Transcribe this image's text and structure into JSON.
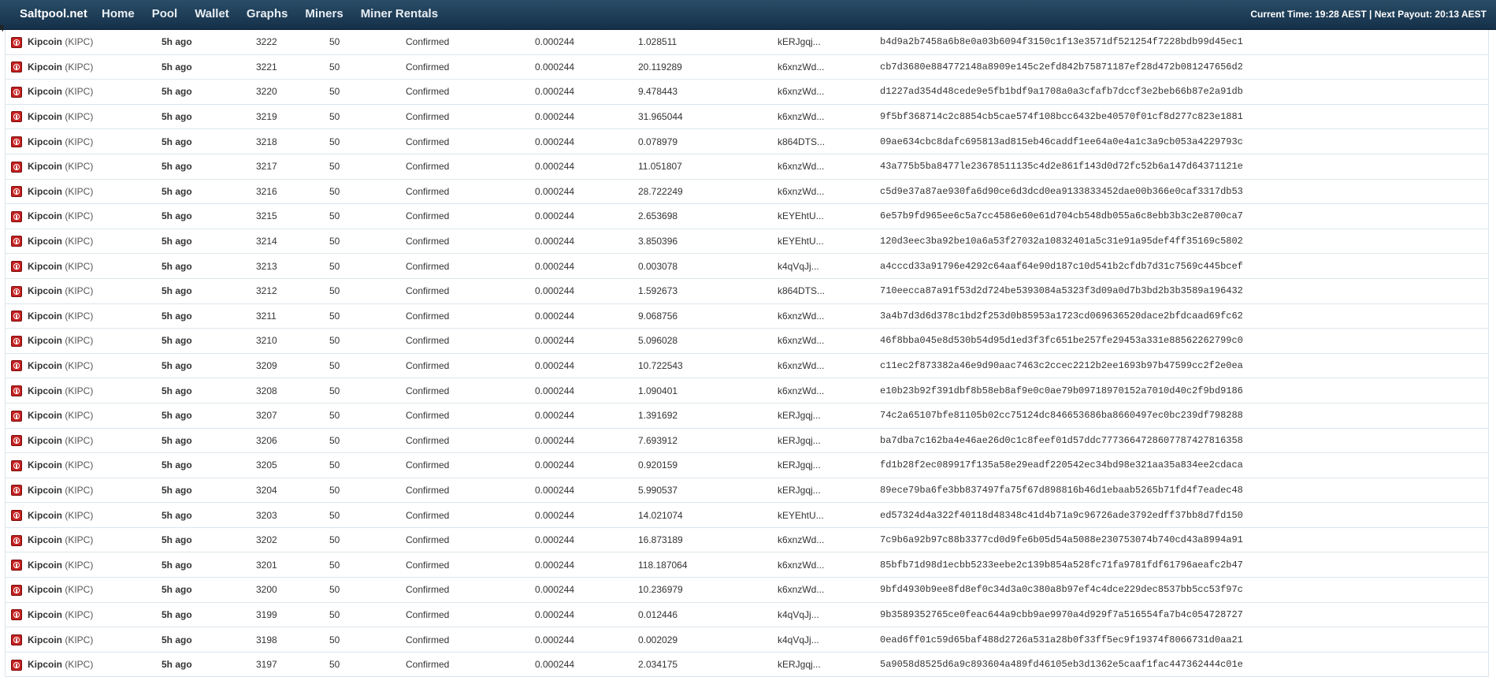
{
  "nav": {
    "brand": "Saltpool.net",
    "links": [
      "Home",
      "Pool",
      "Wallet",
      "Graphs",
      "Miners",
      "Miner Rentals"
    ],
    "status": "Current Time: 19:28 AEST | Next Payout: 20:13 AEST"
  },
  "coin": {
    "name": "Kipcoin",
    "ticker": "(KIPC)",
    "icon": "kipcoin-icon",
    "icon_color": "#c42020"
  },
  "blocks": [
    {
      "time": "5h ago",
      "height": "3222",
      "confirmations": "50",
      "status": "Confirmed",
      "difficulty": "0.000244",
      "reward": "1.028511",
      "finder": "kERJgqj...",
      "hash": "b4d9a2b7458a6b8e0a03b6094f3150c1f13e3571df521254f7228bdb99d45ec1"
    },
    {
      "time": "5h ago",
      "height": "3221",
      "confirmations": "50",
      "status": "Confirmed",
      "difficulty": "0.000244",
      "reward": "20.119289",
      "finder": "k6xnzWd...",
      "hash": "cb7d3680e884772148a8909e145c2efd842b75871187ef28d472b081247656d2"
    },
    {
      "time": "5h ago",
      "height": "3220",
      "confirmations": "50",
      "status": "Confirmed",
      "difficulty": "0.000244",
      "reward": "9.478443",
      "finder": "k6xnzWd...",
      "hash": "d1227ad354d48cede9e5fb1bdf9a1708a0a3cfafb7dccf3e2beb66b87e2a91db"
    },
    {
      "time": "5h ago",
      "height": "3219",
      "confirmations": "50",
      "status": "Confirmed",
      "difficulty": "0.000244",
      "reward": "31.965044",
      "finder": "k6xnzWd...",
      "hash": "9f5bf368714c2c8854cb5cae574f108bcc6432be40570f01cf8d277c823e1881"
    },
    {
      "time": "5h ago",
      "height": "3218",
      "confirmations": "50",
      "status": "Confirmed",
      "difficulty": "0.000244",
      "reward": "0.078979",
      "finder": "k864DTS...",
      "hash": "09ae634cbc8dafc695813ad815eb46caddf1ee64a0e4a1c3a9cb053a4229793c"
    },
    {
      "time": "5h ago",
      "height": "3217",
      "confirmations": "50",
      "status": "Confirmed",
      "difficulty": "0.000244",
      "reward": "11.051807",
      "finder": "k6xnzWd...",
      "hash": "43a775b5ba8477le23678511135c4d2e861f143d0d72fc52b6a147d64371121e"
    },
    {
      "time": "5h ago",
      "height": "3216",
      "confirmations": "50",
      "status": "Confirmed",
      "difficulty": "0.000244",
      "reward": "28.722249",
      "finder": "k6xnzWd...",
      "hash": "c5d9e37a87ae930fa6d90ce6d3dcd0ea9133833452dae00b366e0caf3317db53"
    },
    {
      "time": "5h ago",
      "height": "3215",
      "confirmations": "50",
      "status": "Confirmed",
      "difficulty": "0.000244",
      "reward": "2.653698",
      "finder": "kEYEhtU...",
      "hash": "6e57b9fd965ee6c5a7cc4586e60e61d704cb548db055a6c8ebb3b3c2e8700ca7"
    },
    {
      "time": "5h ago",
      "height": "3214",
      "confirmations": "50",
      "status": "Confirmed",
      "difficulty": "0.000244",
      "reward": "3.850396",
      "finder": "kEYEhtU...",
      "hash": "120d3eec3ba92be10a6a53f27032a10832401a5c31e91a95def4ff35169c5802"
    },
    {
      "time": "5h ago",
      "height": "3213",
      "confirmations": "50",
      "status": "Confirmed",
      "difficulty": "0.000244",
      "reward": "0.003078",
      "finder": "k4qVqJj...",
      "hash": "a4cccd33a91796e4292c64aaf64e90d187c10d541b2cfdb7d31c7569c445bcef"
    },
    {
      "time": "5h ago",
      "height": "3212",
      "confirmations": "50",
      "status": "Confirmed",
      "difficulty": "0.000244",
      "reward": "1.592673",
      "finder": "k864DTS...",
      "hash": "710eecca87a91f53d2d724be5393084a5323f3d09a0d7b3bd2b3b3589a196432"
    },
    {
      "time": "5h ago",
      "height": "3211",
      "confirmations": "50",
      "status": "Confirmed",
      "difficulty": "0.000244",
      "reward": "9.068756",
      "finder": "k6xnzWd...",
      "hash": "3a4b7d3d6d378c1bd2f253d0b85953a1723cd069636520dace2bfdcaad69fc62"
    },
    {
      "time": "5h ago",
      "height": "3210",
      "confirmations": "50",
      "status": "Confirmed",
      "difficulty": "0.000244",
      "reward": "5.096028",
      "finder": "k6xnzWd...",
      "hash": "46f8bba045e8d530b54d95d1ed3f3fc651be257fe29453a331e88562262799c0"
    },
    {
      "time": "5h ago",
      "height": "3209",
      "confirmations": "50",
      "status": "Confirmed",
      "difficulty": "0.000244",
      "reward": "10.722543",
      "finder": "k6xnzWd...",
      "hash": "c11ec2f873382a46e9d90aac7463c2ccec2212b2ee1693b97b47599cc2f2e0ea"
    },
    {
      "time": "5h ago",
      "height": "3208",
      "confirmations": "50",
      "status": "Confirmed",
      "difficulty": "0.000244",
      "reward": "1.090401",
      "finder": "k6xnzWd...",
      "hash": "e10b23b92f391dbf8b58eb8af9e0c0ae79b09718970152a7010d40c2f9bd9186"
    },
    {
      "time": "5h ago",
      "height": "3207",
      "confirmations": "50",
      "status": "Confirmed",
      "difficulty": "0.000244",
      "reward": "1.391692",
      "finder": "kERJgqj...",
      "hash": "74c2a65107bfe81105b02cc75124dc846653686ba8660497ec0bc239df798288"
    },
    {
      "time": "5h ago",
      "height": "3206",
      "confirmations": "50",
      "status": "Confirmed",
      "difficulty": "0.000244",
      "reward": "7.693912",
      "finder": "kERJgqj...",
      "hash": "ba7dba7c162ba4e46ae26d0c1c8feef01d57ddc777366472860778742781635​8"
    },
    {
      "time": "5h ago",
      "height": "3205",
      "confirmations": "50",
      "status": "Confirmed",
      "difficulty": "0.000244",
      "reward": "0.920159",
      "finder": "kERJgqj...",
      "hash": "fd1b28f2ec089917f135a58e29eadf220542ec34bd98e321aa35a834ee2cdaca"
    },
    {
      "time": "5h ago",
      "height": "3204",
      "confirmations": "50",
      "status": "Confirmed",
      "difficulty": "0.000244",
      "reward": "5.990537",
      "finder": "kERJgqj...",
      "hash": "89ece79ba6fe3bb837497fa75f67d898816b46d1ebaab5265b71fd4f7eadec48"
    },
    {
      "time": "5h ago",
      "height": "3203",
      "confirmations": "50",
      "status": "Confirmed",
      "difficulty": "0.000244",
      "reward": "14.021074",
      "finder": "kEYEhtU...",
      "hash": "ed57324d4a322f40118d48348c41d4b71a9c96726ade3792edff37bb8d7fd150"
    },
    {
      "time": "5h ago",
      "height": "3202",
      "confirmations": "50",
      "status": "Confirmed",
      "difficulty": "0.000244",
      "reward": "16.873189",
      "finder": "k6xnzWd...",
      "hash": "7c9b6a92b97c88b3377cd0d9fe6b05d54a5088e230753074b740cd43a8994a91"
    },
    {
      "time": "5h ago",
      "height": "3201",
      "confirmations": "50",
      "status": "Confirmed",
      "difficulty": "0.000244",
      "reward": "118.187064",
      "finder": "k6xnzWd...",
      "hash": "85bfb71d98d1ecbb5233eebe2c139b854a528fc71fa9781fdf61796aeafc2b47"
    },
    {
      "time": "5h ago",
      "height": "3200",
      "confirmations": "50",
      "status": "Confirmed",
      "difficulty": "0.000244",
      "reward": "10.236979",
      "finder": "k6xnzWd...",
      "hash": "9bfd4930b9ee8fd8ef0c34d3a0c380a8b97ef4c4dce229dec8537bb5cc53f97c"
    },
    {
      "time": "5h ago",
      "height": "3199",
      "confirmations": "50",
      "status": "Confirmed",
      "difficulty": "0.000244",
      "reward": "0.012446",
      "finder": "k4qVqJj...",
      "hash": "9b3589352765ce0feac644a9cbb9ae9970a4d929f7a516554fa7b4c054728727"
    },
    {
      "time": "5h ago",
      "height": "3198",
      "confirmations": "50",
      "status": "Confirmed",
      "difficulty": "0.000244",
      "reward": "0.002029",
      "finder": "k4qVqJj...",
      "hash": "0ead6ff01c59d65baf488d2726a531a28b0f33ff5ec9f19374f8066731d0aa21"
    },
    {
      "time": "5h ago",
      "height": "3197",
      "confirmations": "50",
      "status": "Confirmed",
      "difficulty": "0.000244",
      "reward": "2.034175",
      "finder": "kERJgqj...",
      "hash": "5a9058d8525d6a9c893604a489fd46105eb3d1362e5caaf1fac447362444c01e"
    }
  ]
}
